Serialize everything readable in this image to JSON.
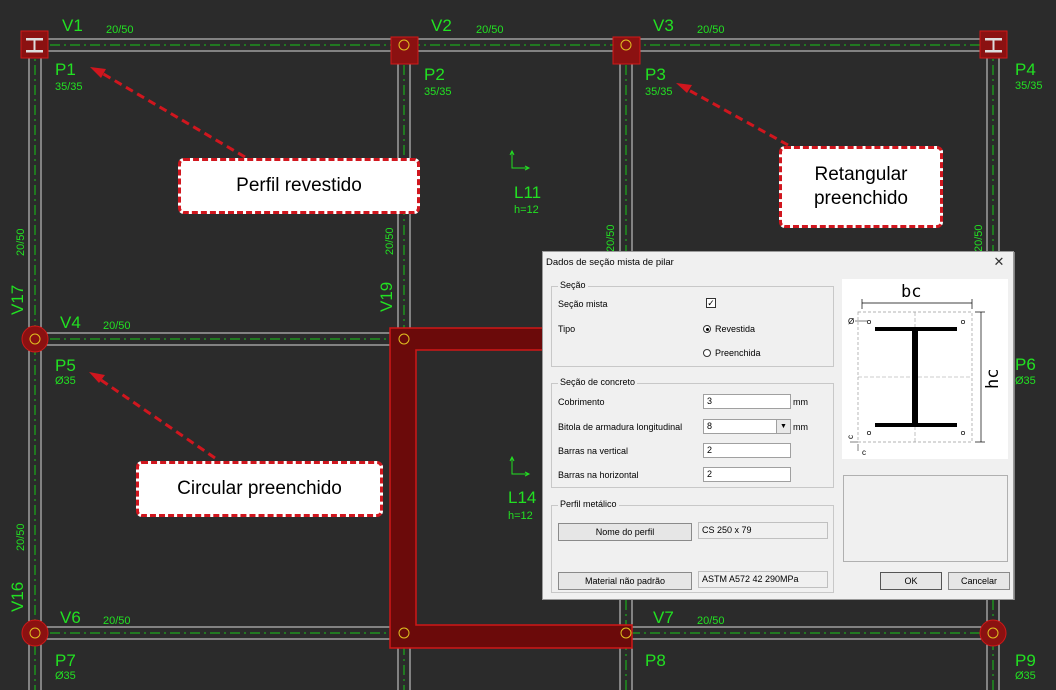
{
  "colors": {
    "background": "#2b2b2b",
    "cad_text": "#22e022",
    "beam_line": "#d8d8d8",
    "beam_center": "#17c517",
    "pillar": "#8b1111",
    "pillar_border": "#d01818",
    "callout_border": "#d0161e"
  },
  "beams": {
    "v1": {
      "name": "V1",
      "section": "20/50"
    },
    "v2": {
      "name": "V2",
      "section": "20/50"
    },
    "v3": {
      "name": "V3",
      "section": "20/50"
    },
    "v4": {
      "name": "V4",
      "section": "20/50"
    },
    "v6": {
      "name": "V6",
      "section": "20/50"
    },
    "v7": {
      "name": "V7",
      "section": "20/50"
    },
    "v16": {
      "name": "V16",
      "section": "20/50"
    },
    "v17": {
      "name": "V17",
      "section": "20/50"
    },
    "v19": {
      "name": "V19",
      "section": "20/50"
    },
    "v_mid": {
      "section": "20/50"
    },
    "v_right": {
      "section": "20/50"
    }
  },
  "pillars": {
    "p1": {
      "name": "P1",
      "section": "35/35"
    },
    "p2": {
      "name": "P2",
      "section": "35/35"
    },
    "p3": {
      "name": "P3",
      "section": "35/35"
    },
    "p4": {
      "name": "P4",
      "section": "35/35"
    },
    "p5": {
      "name": "P5",
      "section": "Ø35"
    },
    "p6": {
      "name": "P6",
      "section": "Ø35"
    },
    "p7": {
      "name": "P7",
      "section": "Ø35"
    },
    "p8": {
      "name": "P8"
    },
    "p9": {
      "name": "P9",
      "section": "Ø35"
    }
  },
  "slabs": {
    "l11": {
      "name": "L11",
      "thickness": "h=12"
    },
    "l14": {
      "name": "L14",
      "thickness": "h=12"
    }
  },
  "callouts": {
    "perfil_revestido": "Perfil revestido",
    "retangular_line1": "Retangular",
    "retangular_line2": "preenchido",
    "circular_preenchido": "Circular preenchido"
  },
  "dialog": {
    "title": "Dados de seção mista de pilar",
    "close": "✕",
    "secao": {
      "title": "Seção",
      "secao_mista_label": "Seção mista",
      "secao_mista_checked": true,
      "tipo_label": "Tipo",
      "options": [
        "Revestida",
        "Preenchida"
      ],
      "selected": "Revestida"
    },
    "concreto": {
      "title": "Seção de concreto",
      "cobrimento_label": "Cobrimento",
      "cobrimento_value": "3",
      "cobrimento_unit": "mm",
      "bitola_label": "Bitola de armadura longitudinal",
      "bitola_value": "8",
      "bitola_unit": "mm",
      "barras_vertical_label": "Barras na vertical",
      "barras_vertical_value": "2",
      "barras_horizontal_label": "Barras na horizontal",
      "barras_horizontal_value": "2"
    },
    "perfil": {
      "title": "Perfil metálico",
      "nome_button": "Nome do perfil",
      "nome_value": "CS 250 x 79",
      "material_button": "Material não padrão",
      "material_value": "ASTM A572 42 290MPa"
    },
    "diagram": {
      "bc": "bc",
      "hc": "hc",
      "phi": "Ø",
      "c1": "c",
      "c2": "c"
    },
    "ok": "OK",
    "cancel": "Cancelar"
  }
}
